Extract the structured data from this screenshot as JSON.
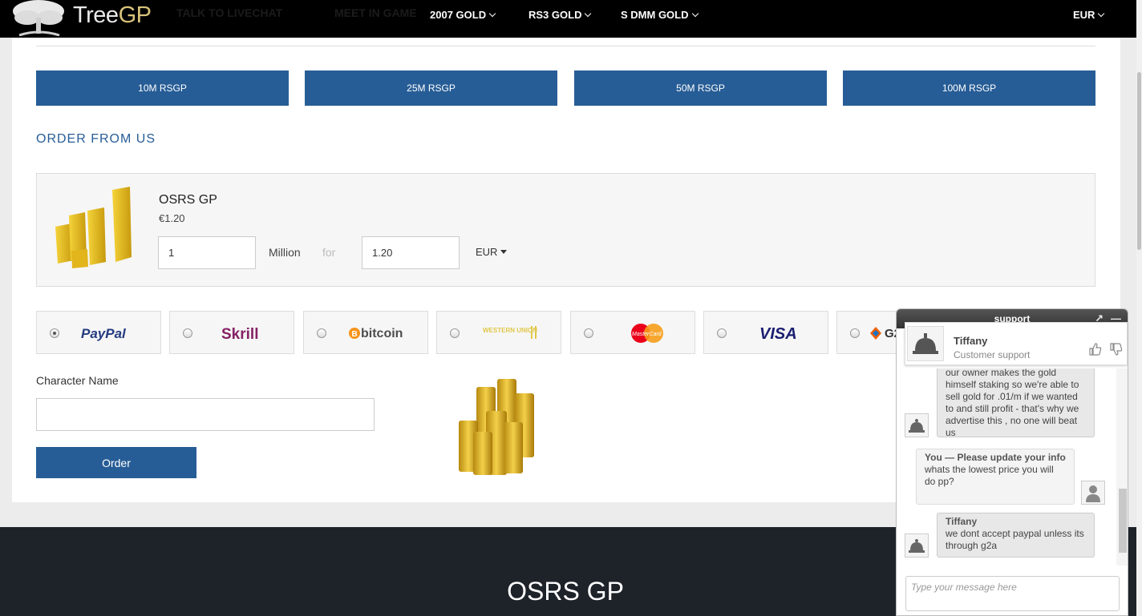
{
  "header": {
    "brand_left": "Tree",
    "brand_right": "GP",
    "hidden_links": [
      "TALK TO LIVECHAT",
      "MEET IN GAME"
    ],
    "nav": [
      "2007 GOLD",
      "RS3 GOLD",
      "S DMM GOLD"
    ],
    "currency": "EUR"
  },
  "packages": [
    "10M RSGP",
    "25M RSGP",
    "50M RSGP",
    "100M RSGP"
  ],
  "order": {
    "section_title": "ORDER FROM US",
    "product_name": "OSRS GP",
    "product_price": "€1.20",
    "amount_value": "1",
    "amount_unit": "Million",
    "for_label": "for",
    "price_value": "1.20",
    "currency": "EUR"
  },
  "payment_methods": [
    {
      "name": "PayPal",
      "selected": true
    },
    {
      "name": "Skrill",
      "selected": false
    },
    {
      "name": "bitcoin",
      "selected": false
    },
    {
      "name": "WESTERN UNION",
      "selected": false
    },
    {
      "name": "MasterCard",
      "selected": false
    },
    {
      "name": "VISA",
      "selected": false
    },
    {
      "name": "G2A",
      "selected": false
    }
  ],
  "form": {
    "character_label": "Character Name",
    "character_value": "",
    "order_button": "Order"
  },
  "footer": {
    "title": "OSRS GP"
  },
  "chat": {
    "header": "support",
    "agent_name": "Tiffany",
    "agent_role": "Customer support",
    "messages": [
      {
        "from": "agent",
        "sender": "",
        "text": "our owner makes the gold himself staking so we're able to sell gold for .01/m if we wanted to and still profit - that's why we advertise this , no one will beat us"
      },
      {
        "from": "me",
        "sender": "You — Please update your info",
        "text": "whats the lowest price you will do pp?"
      },
      {
        "from": "agent",
        "sender": "Tiffany",
        "text": "we dont accept paypal unless its through g2a"
      }
    ],
    "input_placeholder": "Type your message here"
  },
  "colors": {
    "accent": "#275d96",
    "topbar": "#000000",
    "footer": "#1e2229",
    "brand_gp": "#d8c37a"
  }
}
